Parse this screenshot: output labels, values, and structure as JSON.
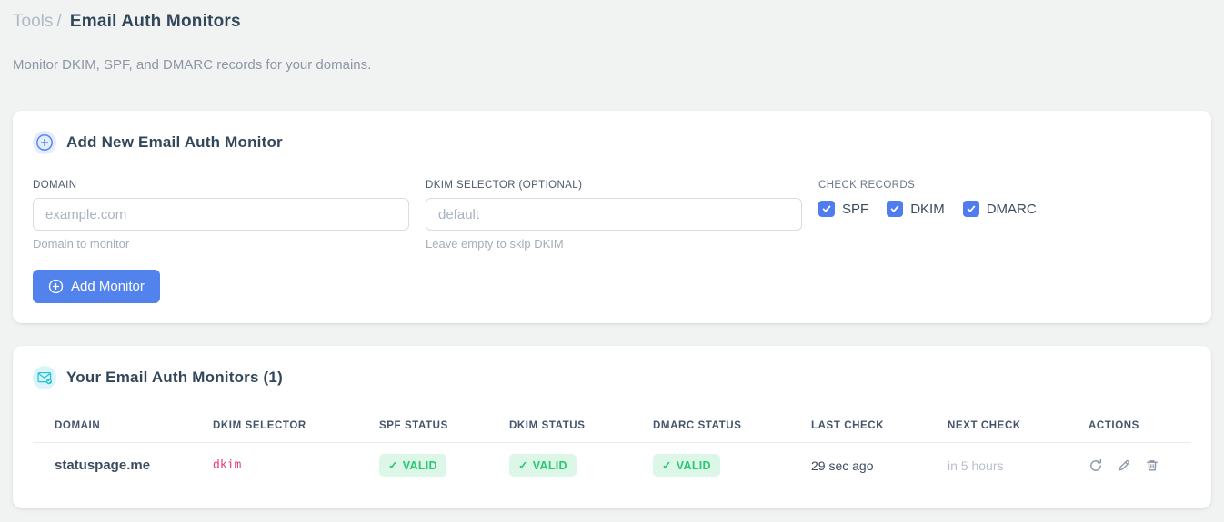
{
  "breadcrumb": {
    "section": "Tools",
    "separator": "/",
    "title": "Email Auth Monitors"
  },
  "subtitle": "Monitor DKIM, SPF, and DMARC records for your domains.",
  "add_card": {
    "title": "Add New Email Auth Monitor",
    "header_icon": "plus-circle-icon",
    "fields": {
      "domain": {
        "label": "DOMAIN",
        "value": "",
        "placeholder": "example.com",
        "helper": "Domain to monitor"
      },
      "dkim_selector": {
        "label": "DKIM SELECTOR (OPTIONAL)",
        "value": "",
        "placeholder": "default",
        "helper": "Leave empty to skip DKIM"
      }
    },
    "check_records": {
      "label": "CHECK RECORDS",
      "options": [
        {
          "label": "SPF",
          "checked": true
        },
        {
          "label": "DKIM",
          "checked": true
        },
        {
          "label": "DMARC",
          "checked": true
        }
      ]
    },
    "submit_label": "Add Monitor"
  },
  "monitors_card": {
    "title": "Your Email Auth Monitors (1)",
    "header_icon": "mail-check-icon",
    "count": 1,
    "table": {
      "headers": [
        "DOMAIN",
        "DKIM SELECTOR",
        "SPF STATUS",
        "DKIM STATUS",
        "DMARC STATUS",
        "LAST CHECK",
        "NEXT CHECK",
        "ACTIONS"
      ],
      "rows": [
        {
          "domain": "statuspage.me",
          "dkim_selector": "dkim",
          "spf_status": "VALID",
          "dkim_status": "VALID",
          "dmarc_status": "VALID",
          "last_check": "29 sec ago",
          "next_check": "in 5 hours",
          "actions": [
            "refresh-icon",
            "edit-icon",
            "delete-icon"
          ]
        }
      ]
    }
  },
  "icons": {
    "badge_check": "✓",
    "checkbox_check": "✓"
  },
  "colors": {
    "accent_blue": "#5282ec",
    "checkbox_blue": "#4f7df0",
    "badge_green": "#2bc873",
    "badge_green_bg": "#dcf7e7",
    "code_pink": "#e83e7c",
    "icon_cyan": "#28c5d5",
    "icon_blue": "#5b87f2",
    "page_bg": "#f1f3f3"
  }
}
